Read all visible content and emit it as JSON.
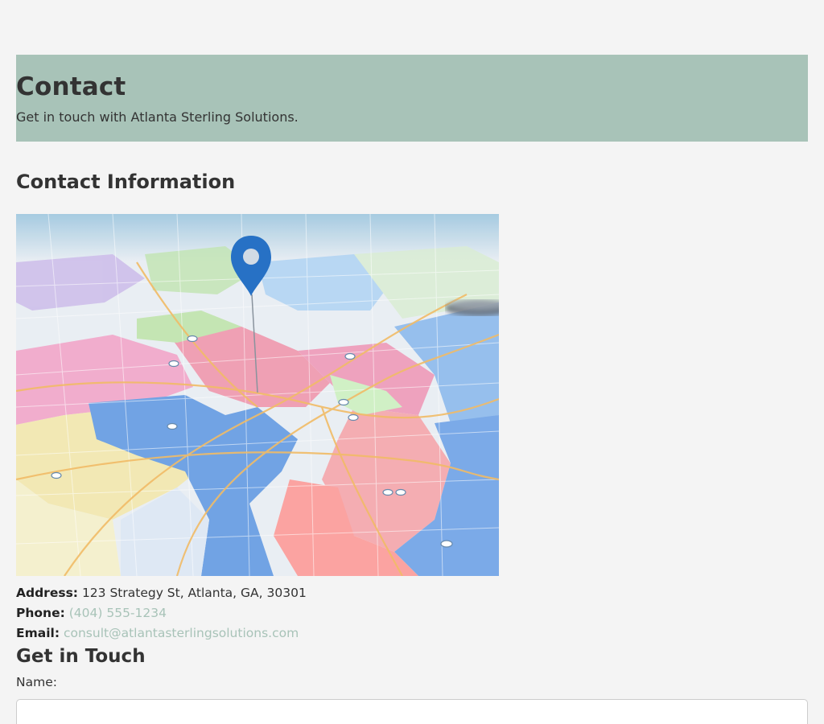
{
  "hero": {
    "title": "Contact",
    "subtitle": "Get in touch with Atlanta Sterling Solutions."
  },
  "contact_info": {
    "title": "Contact Information",
    "address_label": "Address:",
    "address_value": "123 Strategy St, Atlanta, GA, 30301",
    "phone_label": "Phone:",
    "phone_value": "(404) 555-1234",
    "email_label": "Email:",
    "email_value": "consult@atlantasterlingsolutions.com"
  },
  "form": {
    "title": "Get in Touch",
    "name_label": "Name:",
    "name_value": ""
  },
  "colors": {
    "accent": "#a8c3b8",
    "background": "#f4f4f4",
    "text": "#333333",
    "map_pin": "#1565c0"
  },
  "icons": {
    "map_pin": "map-pin-icon"
  }
}
